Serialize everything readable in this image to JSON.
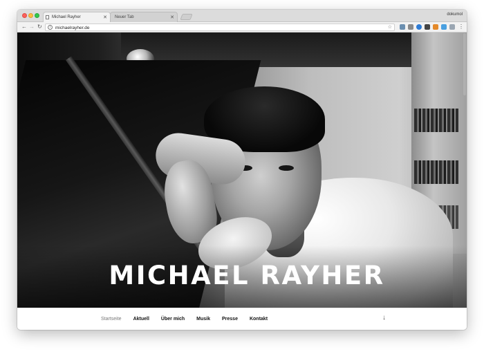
{
  "browser": {
    "tabs": [
      {
        "title": "Michael Rayher",
        "active": true
      },
      {
        "title": "Neuer Tab",
        "active": false
      }
    ],
    "profile_name": "dokumol",
    "url": "michaelrayher.de"
  },
  "hero": {
    "title": "MICHAEL RAYHER"
  },
  "nav": {
    "items": [
      "Startseite",
      "Aktuell",
      "Über mich",
      "Musik",
      "Presse",
      "Kontakt"
    ],
    "current": "Startseite"
  },
  "colors": {
    "traffic_close": "#fc605c",
    "traffic_minimize": "#fdbc40",
    "traffic_maximize": "#34c84a",
    "nav_current": "#777777",
    "nav_text": "#111111"
  },
  "icons": {
    "scroll_down": "arrow-down-icon",
    "bookmark": "star-icon",
    "menu": "kebab-menu-icon"
  }
}
